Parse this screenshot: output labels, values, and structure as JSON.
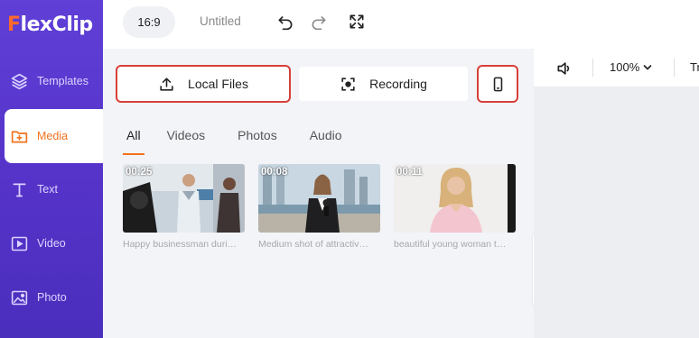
{
  "app": {
    "logo_text": "FlexClip",
    "brand_orange": "#f2711c",
    "sidebar_color": "#5a38cf"
  },
  "sidebar": {
    "items": [
      {
        "label": "Templates",
        "icon": "layers-icon",
        "active": false
      },
      {
        "label": "Media",
        "icon": "folder-plus-icon",
        "active": true
      },
      {
        "label": "Text",
        "icon": "text-icon",
        "active": false
      },
      {
        "label": "Video",
        "icon": "video-play-icon",
        "active": false
      },
      {
        "label": "Photo",
        "icon": "image-icon",
        "active": false
      }
    ]
  },
  "topbar": {
    "aspect_ratio": "16:9",
    "project_title": "Untitled",
    "icons": [
      "undo-icon",
      "redo-icon",
      "fullscreen-icon"
    ]
  },
  "media_panel": {
    "local_files_label": "Local Files",
    "recording_label": "Recording",
    "mobile_icon": "phone-icon",
    "tabs": [
      {
        "label": "All",
        "active": true
      },
      {
        "label": "Videos",
        "active": false
      },
      {
        "label": "Photos",
        "active": false
      },
      {
        "label": "Audio",
        "active": false
      }
    ],
    "items": [
      {
        "duration": "00:25",
        "caption": "Happy businessman duri…"
      },
      {
        "duration": "00:08",
        "caption": "Medium shot of attractiv…"
      },
      {
        "duration": "00:11",
        "caption": "beautiful young woman t…"
      }
    ]
  },
  "editor_toolbar": {
    "zoom": "100%",
    "truncated_text": "Tr"
  }
}
